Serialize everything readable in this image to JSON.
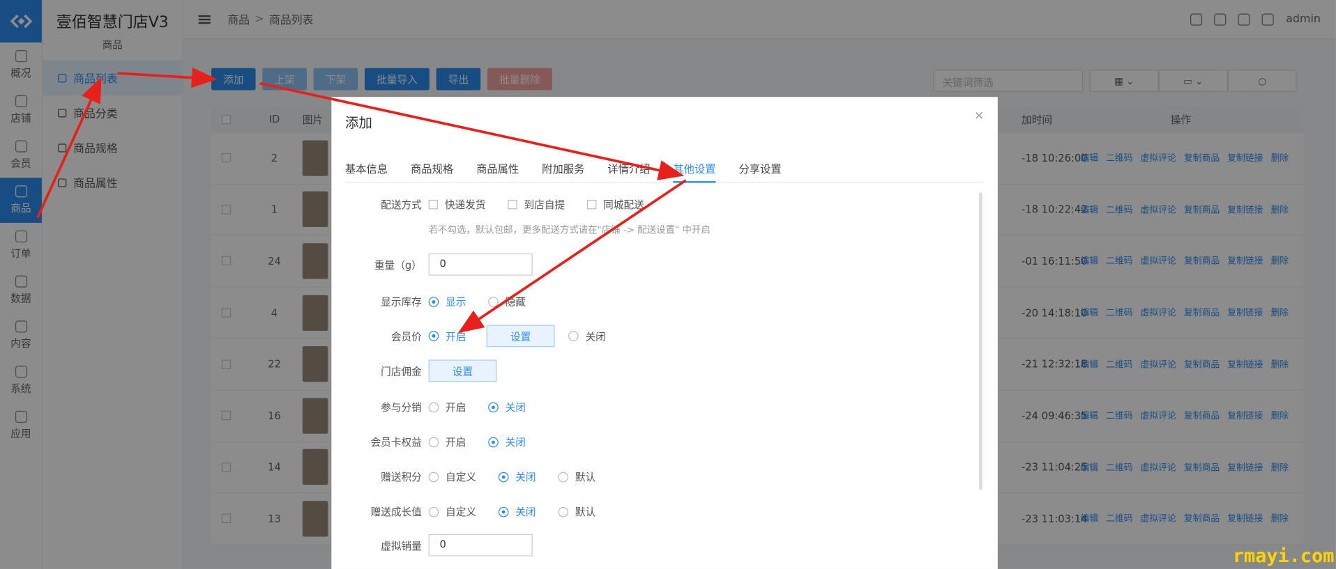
{
  "app": {
    "title": "壹佰智慧门店V3",
    "section": "商品"
  },
  "rail": [
    {
      "label": "概况"
    },
    {
      "label": "店铺"
    },
    {
      "label": "会员"
    },
    {
      "label": "商品"
    },
    {
      "label": "订单"
    },
    {
      "label": "数据"
    },
    {
      "label": "内容"
    },
    {
      "label": "系统"
    },
    {
      "label": "应用"
    }
  ],
  "subnav": [
    {
      "label": "商品列表"
    },
    {
      "label": "商品分类"
    },
    {
      "label": "商品规格"
    },
    {
      "label": "商品属性"
    }
  ],
  "breadcrumb": {
    "root": "商品",
    "sep": ">",
    "current": "商品列表"
  },
  "user": {
    "name": "admin"
  },
  "toolbar": {
    "add": "添加",
    "up": "上架",
    "down": "下架",
    "import": "批量导入",
    "export": "导出",
    "delete": "批量删除"
  },
  "search": {
    "placeholder": "关键词筛选"
  },
  "table": {
    "headers": {
      "id": "ID",
      "img": "图片",
      "time": "加时间",
      "ops": "操作"
    },
    "rows": [
      {
        "id": "2",
        "time": "-18 10:26:00"
      },
      {
        "id": "1",
        "time": "-18 10:22:42"
      },
      {
        "id": "24",
        "time": "-01 16:11:50"
      },
      {
        "id": "4",
        "time": "-20 14:18:10"
      },
      {
        "id": "22",
        "time": "-21 12:32:18"
      },
      {
        "id": "16",
        "time": "-24 09:46:35"
      },
      {
        "id": "14",
        "time": "-23 11:04:25"
      },
      {
        "id": "13",
        "time": "-23 11:03:14"
      }
    ],
    "ops": [
      "编辑",
      "二维码",
      "虚拟评论",
      "复制商品",
      "复制链接",
      "删除"
    ]
  },
  "modal": {
    "title": "添加",
    "close": "×",
    "tabs": [
      "基本信息",
      "商品规格",
      "商品属性",
      "附加服务",
      "详情介绍",
      "其他设置",
      "分享设置"
    ],
    "active_tab": 5,
    "delivery": {
      "label": "配送方式",
      "options": [
        "快递发货",
        "到店自提",
        "同城配送"
      ],
      "hint": "若不勾选，默认包邮，更多配送方式请在\"店铺 -> 配送设置\" 中开启"
    },
    "weight": {
      "label": "重量（g）",
      "value": "0"
    },
    "stock": {
      "label": "显示库存",
      "on": "显示",
      "off": "隐藏"
    },
    "member_price": {
      "label": "会员价",
      "on": "开启",
      "set": "设置",
      "off": "关闭"
    },
    "commission": {
      "label": "门店佣金",
      "set": "设置"
    },
    "distribution": {
      "label": "参与分销",
      "on": "开启",
      "off": "关闭"
    },
    "card_rights": {
      "label": "会员卡权益",
      "on": "开启",
      "off": "关闭"
    },
    "points": {
      "label": "赠送积分",
      "custom": "自定义",
      "off": "关闭",
      "default": "默认"
    },
    "growth": {
      "label": "赠送成长值",
      "custom": "自定义",
      "off": "关闭",
      "default": "默认"
    },
    "virtual_sales": {
      "label": "虚拟销量",
      "value": "0"
    }
  },
  "watermark": "rmayi.com",
  "colors": {
    "accent": "#2d8cf0",
    "arrow": "#e8201c",
    "watermark": "#ffd400"
  }
}
